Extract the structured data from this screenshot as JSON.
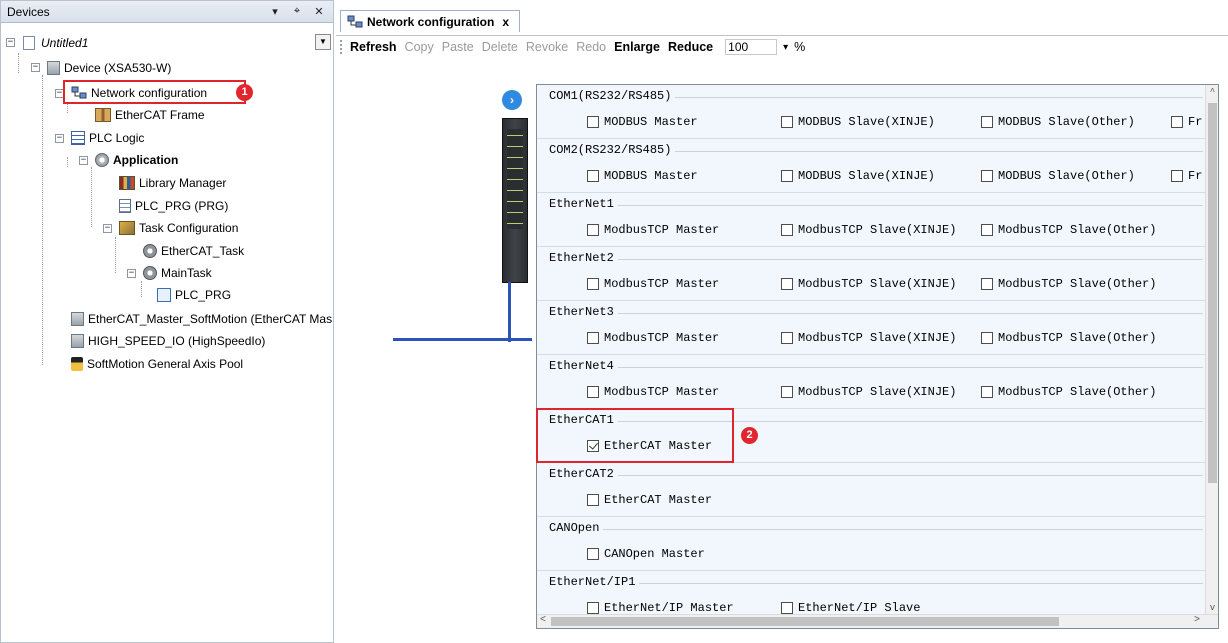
{
  "devices_panel": {
    "title": "Devices",
    "header_buttons": [
      "▾",
      "⌖",
      "✕"
    ],
    "tree": {
      "project": "Untitled1",
      "device": "Device (XSA530-W)",
      "network_configuration": "Network configuration",
      "ethercat_frame": "EtherCAT Frame",
      "plc_logic": "PLC Logic",
      "application": "Application",
      "library_manager": "Library Manager",
      "plc_prg": "PLC_PRG (PRG)",
      "task_configuration": "Task Configuration",
      "ethercat_task": "EtherCAT_Task",
      "main_task": "MainTask",
      "main_task_prg": "PLC_PRG",
      "ethercat_master": "EtherCAT_Master_SoftMotion (EtherCAT Mas",
      "high_speed_io": "HIGH_SPEED_IO (HighSpeedIo)",
      "axis_pool": "SoftMotion General Axis Pool"
    }
  },
  "annotations": {
    "badge1": "1",
    "badge2": "2"
  },
  "tab": {
    "label": "Network configuration",
    "close": "x"
  },
  "toolbar": {
    "refresh": "Refresh",
    "copy": "Copy",
    "paste": "Paste",
    "delete": "Delete",
    "revoke": "Revoke",
    "redo": "Redo",
    "enlarge": "Enlarge",
    "reduce": "Reduce",
    "zoom_value": "100",
    "zoom_arrow": "▾",
    "zoom_unit": "%"
  },
  "expand_icon": "›",
  "network_config": {
    "groups": [
      {
        "title": "COM1(RS232/RS485)",
        "options": [
          {
            "label": "MODBUS Master",
            "checked": false
          },
          {
            "label": "MODBUS Slave(XINJE)",
            "checked": false
          },
          {
            "label": "MODBUS Slave(Other)",
            "checked": false
          },
          {
            "label": "Fr",
            "checked": false
          }
        ]
      },
      {
        "title": "COM2(RS232/RS485)",
        "options": [
          {
            "label": "MODBUS Master",
            "checked": false
          },
          {
            "label": "MODBUS Slave(XINJE)",
            "checked": false
          },
          {
            "label": "MODBUS Slave(Other)",
            "checked": false
          },
          {
            "label": "Fr",
            "checked": false
          }
        ]
      },
      {
        "title": "EtherNet1",
        "options": [
          {
            "label": "ModbusTCP Master",
            "checked": false
          },
          {
            "label": "ModbusTCP Slave(XINJE)",
            "checked": false
          },
          {
            "label": "ModbusTCP Slave(Other)",
            "checked": false
          }
        ]
      },
      {
        "title": "EtherNet2",
        "options": [
          {
            "label": "ModbusTCP Master",
            "checked": false
          },
          {
            "label": "ModbusTCP Slave(XINJE)",
            "checked": false
          },
          {
            "label": "ModbusTCP Slave(Other)",
            "checked": false
          }
        ]
      },
      {
        "title": "EtherNet3",
        "options": [
          {
            "label": "ModbusTCP Master",
            "checked": false
          },
          {
            "label": "ModbusTCP Slave(XINJE)",
            "checked": false
          },
          {
            "label": "ModbusTCP Slave(Other)",
            "checked": false
          }
        ]
      },
      {
        "title": "EtherNet4",
        "options": [
          {
            "label": "ModbusTCP Master",
            "checked": false
          },
          {
            "label": "ModbusTCP Slave(XINJE)",
            "checked": false
          },
          {
            "label": "ModbusTCP Slave(Other)",
            "checked": false
          }
        ]
      },
      {
        "title": "EtherCAT1",
        "options": [
          {
            "label": "EtherCAT Master",
            "checked": true
          }
        ]
      },
      {
        "title": "EtherCAT2",
        "options": [
          {
            "label": "EtherCAT Master",
            "checked": false
          }
        ]
      },
      {
        "title": "CANOpen",
        "options": [
          {
            "label": "CANOpen Master",
            "checked": false
          }
        ]
      },
      {
        "title": "EtherNet/IP1",
        "options": [
          {
            "label": "EtherNet/IP Master",
            "checked": false
          },
          {
            "label": "EtherNet/IP Slave",
            "checked": false
          }
        ]
      }
    ]
  },
  "scroll": {
    "up": "^",
    "down": "v",
    "left": "<",
    "right": ">"
  },
  "colors": {
    "highlight_red": "#e0242d",
    "bus_blue": "#2a54b8",
    "panel_bg": "#f1f7fc"
  }
}
